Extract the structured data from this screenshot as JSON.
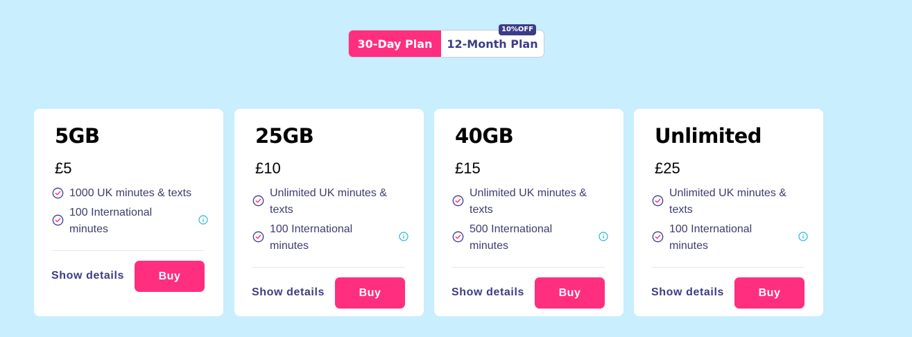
{
  "toggle": {
    "monthly_label": "30-Day Plan",
    "yearly_label": "12-Month Plan",
    "discount_badge": "10%OFF",
    "active": "30-Day Plan"
  },
  "colors": {
    "background": "#c9eefd",
    "accent": "#ff2e7e",
    "navy": "#3b3c89",
    "info": "#22b6d6"
  },
  "plans": [
    {
      "title": "5GB",
      "price": "£5",
      "features": [
        "1000 UK minutes & texts",
        "100 International minutes"
      ],
      "show_details": "Show details",
      "buy": "Buy"
    },
    {
      "title": "25GB",
      "price": "£10",
      "features": [
        "Unlimited UK minutes & texts",
        "100 International minutes"
      ],
      "show_details": "Show details",
      "buy": "Buy"
    },
    {
      "title": "40GB",
      "price": "£15",
      "features": [
        "Unlimited UK minutes & texts",
        "500 International minutes"
      ],
      "show_details": "Show details",
      "buy": "Buy"
    },
    {
      "title": "Unlimited",
      "price": "£25",
      "features": [
        "Unlimited UK minutes & texts",
        "100 International minutes"
      ],
      "show_details": "Show details",
      "buy": "Buy"
    }
  ]
}
